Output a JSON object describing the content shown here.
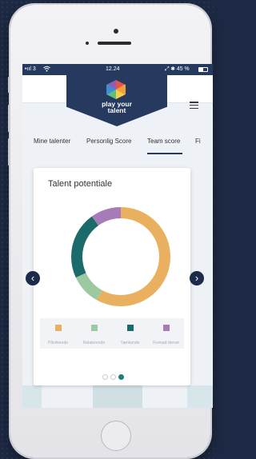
{
  "statusbar": {
    "signal": "•ııl 3",
    "wifi": "wifi-icon",
    "time": "12.24",
    "battery": "⤢ ✱ 45 %"
  },
  "header": {
    "logo": "play-your-talent-logo-icon",
    "logo_text_line1": "play your",
    "logo_text_line2": "talent",
    "menu_icon": "hamburger-menu-icon"
  },
  "tabs": [
    {
      "label": "Mine talenter",
      "active": false
    },
    {
      "label": "Personlig Score",
      "active": false
    },
    {
      "label": "Team score",
      "active": true
    },
    {
      "label": "Fi",
      "active": false
    }
  ],
  "card": {
    "title": "Talent potentiale"
  },
  "chart_data": {
    "type": "pie",
    "title": "Talent potentiale",
    "categories": [
      "Påvirkende",
      "Relaterende",
      "Tænkende",
      "Fremad drevet"
    ],
    "values": [
      58,
      10,
      22,
      10
    ],
    "colors": [
      "#e9b15f",
      "#9cc9a0",
      "#1b6b6a",
      "#a57bb8"
    ],
    "donut": true,
    "legend_placement": "bottom"
  },
  "pager": {
    "pages": 3,
    "active": 3
  },
  "nav": {
    "prev_icon": "chevron-left-icon",
    "next_icon": "chevron-right-icon",
    "prev_glyph": "‹",
    "next_glyph": "›"
  },
  "colors": {
    "brand_navy": "#253a5e",
    "accent_teal": "#1f7d7a"
  }
}
